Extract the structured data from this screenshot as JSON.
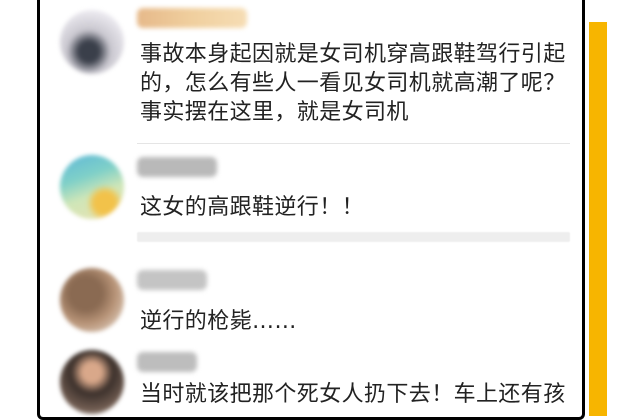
{
  "theme": {
    "accent_color": "#f7b500",
    "card_border_color": "#000000",
    "text_color": "#222222",
    "divider_color": "#e5e5e5"
  },
  "comments": [
    {
      "avatar": "blurred-user-avatar",
      "username_blurred": true,
      "text_lines": [
        "事故本身起因就是女司机穿高跟鞋驾行引起",
        "的，怎么有些人一看见女司机就高潮了呢？",
        "事实摆在这里，就是女司机"
      ]
    },
    {
      "avatar": "blurred-user-avatar",
      "username_blurred": true,
      "text_lines": [
        "这女的高跟鞋逆行！！"
      ]
    },
    {
      "avatar": "blurred-user-avatar",
      "username_blurred": true,
      "text_lines": [
        "逆行的枪毙……"
      ]
    },
    {
      "avatar": "blurred-user-avatar",
      "username_blurred": true,
      "text_lines": [
        "当时就该把那个死女人扔下去！车上还有孩"
      ]
    }
  ]
}
